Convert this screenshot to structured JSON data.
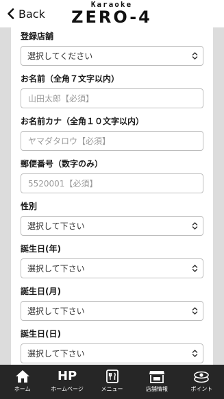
{
  "header": {
    "back_label": "Back",
    "logo_small": "Karaoke",
    "logo_big": "ZERO-4"
  },
  "form": {
    "fields": [
      {
        "label": "登録店舗",
        "value": "選択してください",
        "type": "select"
      },
      {
        "label": "お名前（全角７文字以内）",
        "placeholder": "山田太郎【必須】",
        "type": "input"
      },
      {
        "label": "お名前カナ（全角１０文字以内）",
        "placeholder": "ヤマダタロウ【必須】",
        "type": "input"
      },
      {
        "label": "郵便番号（数字のみ）",
        "placeholder": "5520001【必須】",
        "type": "input"
      },
      {
        "label": "性別",
        "value": "選択して下さい",
        "type": "select"
      },
      {
        "label": "誕生日(年)",
        "value": "選択して下さい",
        "type": "select"
      },
      {
        "label": "誕生日(月)",
        "value": "選択して下さい",
        "type": "select"
      },
      {
        "label": "誕生日(日)",
        "value": "選択して下さい",
        "type": "select"
      }
    ]
  },
  "nav": {
    "items": [
      {
        "label": "ホーム",
        "icon": "home-icon"
      },
      {
        "label": "ホームページ",
        "icon": "hp-icon",
        "icon_text": "HP"
      },
      {
        "label": "メニュー",
        "icon": "menu-icon"
      },
      {
        "label": "店舗情報",
        "icon": "store-icon"
      },
      {
        "label": "ポイント",
        "icon": "point-icon"
      }
    ]
  }
}
